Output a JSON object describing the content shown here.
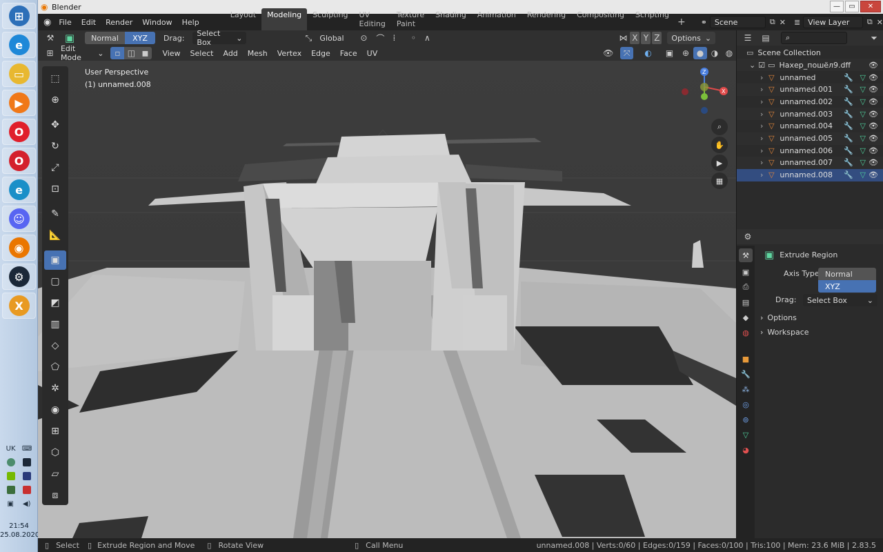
{
  "taskbar": {
    "lang": "UK",
    "time": "21:54",
    "date": "25.08.2020",
    "apps": [
      {
        "name": "windows-start",
        "color": "#2c6fb8",
        "glyph": "⊞"
      },
      {
        "name": "internet-explorer",
        "color": "#1e88d8",
        "glyph": "e"
      },
      {
        "name": "file-explorer",
        "color": "#e8b830",
        "glyph": "▭"
      },
      {
        "name": "media-player",
        "color": "#f07818",
        "glyph": "▶"
      },
      {
        "name": "opera",
        "color": "#e01f2b",
        "glyph": "O"
      },
      {
        "name": "opera-gx",
        "color": "#d4202c",
        "glyph": "O"
      },
      {
        "name": "edge",
        "color": "#1a8fc8",
        "glyph": "e"
      },
      {
        "name": "discord",
        "color": "#5865f2",
        "glyph": "☺"
      },
      {
        "name": "blender",
        "color": "#ea7600",
        "glyph": "◉"
      },
      {
        "name": "steam",
        "color": "#1b2838",
        "glyph": "⚙"
      },
      {
        "name": "xampp",
        "color": "#e89a22",
        "glyph": "X"
      }
    ]
  },
  "window": {
    "title": "Blender",
    "min": "—",
    "max": "▭",
    "close": "✕"
  },
  "menu": [
    "File",
    "Edit",
    "Render",
    "Window",
    "Help"
  ],
  "workspaces": [
    "Layout",
    "Modeling",
    "Sculpting",
    "UV Editing",
    "Texture Paint",
    "Shading",
    "Animation",
    "Rendering",
    "Compositing",
    "Scripting"
  ],
  "active_workspace": "Modeling",
  "scene": {
    "name": "Scene",
    "view_layer": "View Layer"
  },
  "header1": {
    "axis_normal": "Normal",
    "axis_xyz": "XYZ",
    "drag_label": "Drag:",
    "drag_value": "Select Box",
    "orientation": "Global",
    "axes": [
      "X",
      "Y",
      "Z"
    ],
    "options": "Options"
  },
  "header2": {
    "mode": "Edit Mode",
    "menus": [
      "View",
      "Select",
      "Add",
      "Mesh",
      "Vertex",
      "Edge",
      "Face",
      "UV"
    ]
  },
  "viewport": {
    "perspective": "User Perspective",
    "object": "(1) unnamed.008"
  },
  "outliner": {
    "collection": "Scene Collection",
    "file": "Нахер_пошёл9.dff",
    "objects": [
      "unnamed",
      "unnamed.001",
      "unnamed.002",
      "unnamed.003",
      "unnamed.004",
      "unnamed.005",
      "unnamed.006",
      "unnamed.007",
      "unnamed.008"
    ]
  },
  "props": {
    "panel_title": "Extrude Region",
    "axis_type_label": "Axis Type",
    "axis_options": [
      "Normal",
      "XYZ"
    ],
    "drag_label": "Drag:",
    "drag_value": "Select Box",
    "sections": [
      "Options",
      "Workspace"
    ]
  },
  "status": {
    "select": "Select",
    "extrude": "Extrude Region and Move",
    "rotate": "Rotate View",
    "call_menu": "Call Menu",
    "info": "unnamed.008 | Verts:0/60 | Edges:0/159 | Faces:0/100 | Tris:100 | Mem: 23.6 MiB | 2.83.5"
  }
}
